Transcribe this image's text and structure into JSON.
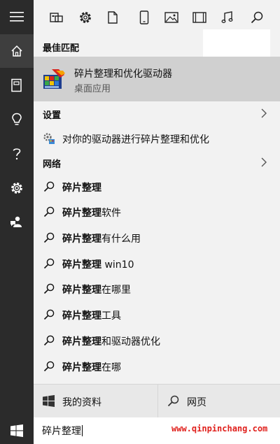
{
  "topbar": {
    "filters": [
      "apps-icon",
      "settings-icon",
      "documents-icon",
      "tablet-icon",
      "photos-icon",
      "videos-icon",
      "music-icon",
      "search-icon"
    ]
  },
  "rail": {
    "items": [
      "hamburger-icon",
      "home-icon",
      "notebook-icon",
      "lightbulb-icon",
      "help-icon",
      "gear-icon",
      "feedback-icon"
    ]
  },
  "sections": {
    "best_match": "最佳匹配",
    "settings": "设置",
    "network": "网络"
  },
  "best_match_item": {
    "title": "碎片整理和优化驱动器",
    "subtitle": "桌面应用"
  },
  "settings_item": {
    "label": "对你的驱动器进行碎片整理和优化"
  },
  "suggestions": [
    {
      "bold": "碎片整理",
      "rest": ""
    },
    {
      "bold": "碎片整理",
      "rest": "软件"
    },
    {
      "bold": "碎片整理",
      "rest": "有什么用"
    },
    {
      "bold": "碎片整理",
      "rest": " win10"
    },
    {
      "bold": "碎片整理",
      "rest": "在哪里"
    },
    {
      "bold": "碎片整理",
      "rest": "工具"
    },
    {
      "bold": "碎片整理",
      "rest": "和驱动器优化"
    },
    {
      "bold": "碎片整理",
      "rest": "在哪"
    }
  ],
  "bottom": {
    "my_stuff": "我的资料",
    "web": "网页"
  },
  "search": {
    "query": "碎片整理"
  },
  "watermark": "www.qinpinchang.com",
  "colors": {
    "rail": "#2b2b2b",
    "highlight": "#d0d0d0",
    "watermark": "#e0201c"
  }
}
